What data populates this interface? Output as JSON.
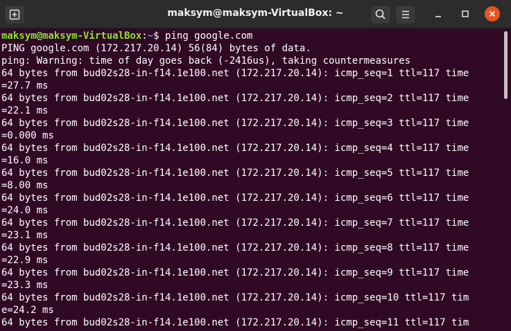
{
  "window": {
    "title": "maksym@maksym-VirtualBox: ~"
  },
  "titlebar": {
    "icons": [
      "new-tab-icon",
      "search-icon",
      "hamburger-menu-icon",
      "minimize-icon",
      "maximize-icon",
      "close-icon"
    ],
    "accent_close": "#e95420"
  },
  "terminal": {
    "background": "#300a24",
    "prompt": {
      "user_host": "maksym@maksym-VirtualBox",
      "separator": ":",
      "path": "~",
      "symbol": "$ ",
      "command": "ping google.com"
    },
    "lines": [
      "PING google.com (172.217.20.14) 56(84) bytes of data.",
      "ping: Warning: time of day goes back (-2416us), taking countermeasures",
      "64 bytes from bud02s28-in-f14.1e100.net (172.217.20.14): icmp_seq=1 ttl=117 time",
      "=27.7 ms",
      "64 bytes from bud02s28-in-f14.1e100.net (172.217.20.14): icmp_seq=2 ttl=117 time",
      "=22.1 ms",
      "64 bytes from bud02s28-in-f14.1e100.net (172.217.20.14): icmp_seq=3 ttl=117 time",
      "=0.000 ms",
      "64 bytes from bud02s28-in-f14.1e100.net (172.217.20.14): icmp_seq=4 ttl=117 time",
      "=16.0 ms",
      "64 bytes from bud02s28-in-f14.1e100.net (172.217.20.14): icmp_seq=5 ttl=117 time",
      "=8.00 ms",
      "64 bytes from bud02s28-in-f14.1e100.net (172.217.20.14): icmp_seq=6 ttl=117 time",
      "=24.0 ms",
      "64 bytes from bud02s28-in-f14.1e100.net (172.217.20.14): icmp_seq=7 ttl=117 time",
      "=23.1 ms",
      "64 bytes from bud02s28-in-f14.1e100.net (172.217.20.14): icmp_seq=8 ttl=117 time",
      "=22.9 ms",
      "64 bytes from bud02s28-in-f14.1e100.net (172.217.20.14): icmp_seq=9 ttl=117 time",
      "=23.3 ms",
      "64 bytes from bud02s28-in-f14.1e100.net (172.217.20.14): icmp_seq=10 ttl=117 tim",
      "e=24.2 ms",
      "64 bytes from bud02s28-in-f14.1e100.net (172.217.20.14): icmp_seq=11 ttl=117 tim"
    ]
  },
  "scrollbar": {
    "position_fraction": 0.0
  }
}
